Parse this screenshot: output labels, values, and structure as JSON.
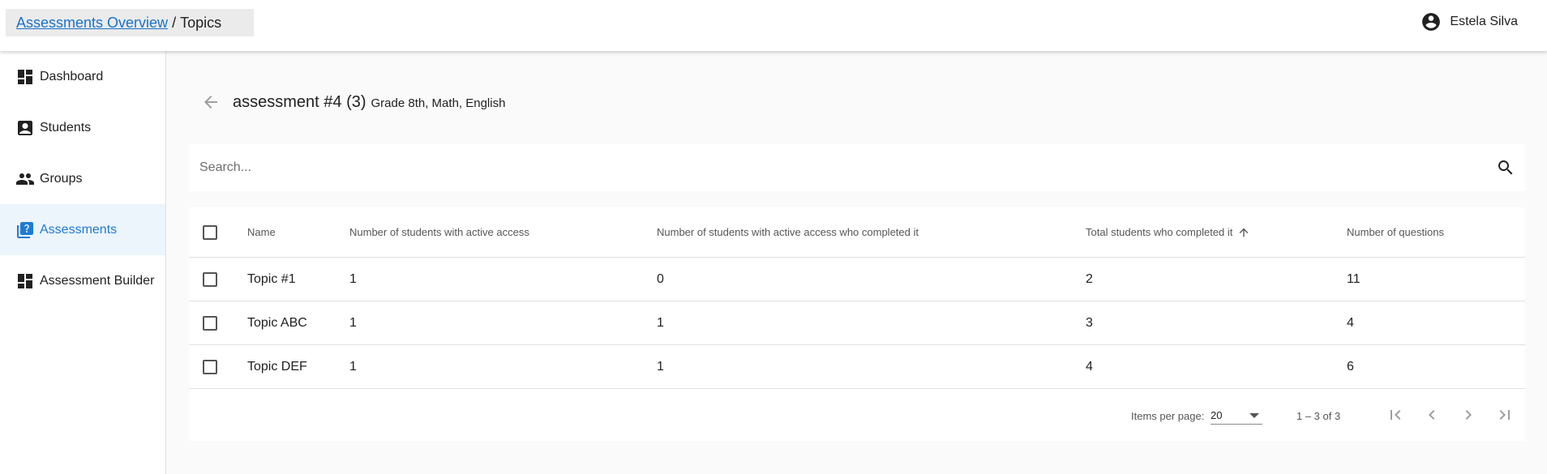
{
  "header": {
    "breadcrumb_link": "Assessments Overview",
    "breadcrumb_separator": "/",
    "breadcrumb_current": "Topics",
    "user_name": "Estela Silva",
    "user_icon": "account-circle-icon"
  },
  "sidebar": {
    "items": [
      {
        "label": "Dashboard",
        "icon": "dashboard-icon",
        "active": false
      },
      {
        "label": "Students",
        "icon": "student-badge-icon",
        "active": false
      },
      {
        "label": "Groups",
        "icon": "people-icon",
        "active": false
      },
      {
        "label": "Assessments",
        "icon": "quiz-icon",
        "active": true
      },
      {
        "label": "Assessment Builder",
        "icon": "builder-icon",
        "active": false
      }
    ]
  },
  "page": {
    "title": "assessment #4 (3)",
    "subtitle": "Grade 8th, Math, English"
  },
  "search": {
    "placeholder": "Search..."
  },
  "table": {
    "columns": [
      "Name",
      "Number of students with active access",
      "Number of students with active access who completed it",
      "Total students who completed it",
      "Number of questions"
    ],
    "sorted_column": "Total students who completed it",
    "sort_direction": "ascending",
    "rows": [
      [
        "Topic #1",
        "1",
        "0",
        "2",
        "11"
      ],
      [
        "Topic ABC",
        "1",
        "1",
        "3",
        "4"
      ],
      [
        "Topic DEF",
        "1",
        "1",
        "4",
        "6"
      ]
    ]
  },
  "paginator": {
    "items_per_page_label": "Items per page:",
    "items_per_page_value": "20",
    "range_label": "1 – 3 of 3"
  },
  "colors": {
    "accent": "#1f7bd1",
    "active_nav_bg": "#ecf4fc",
    "page_bg": "#fafafa"
  }
}
